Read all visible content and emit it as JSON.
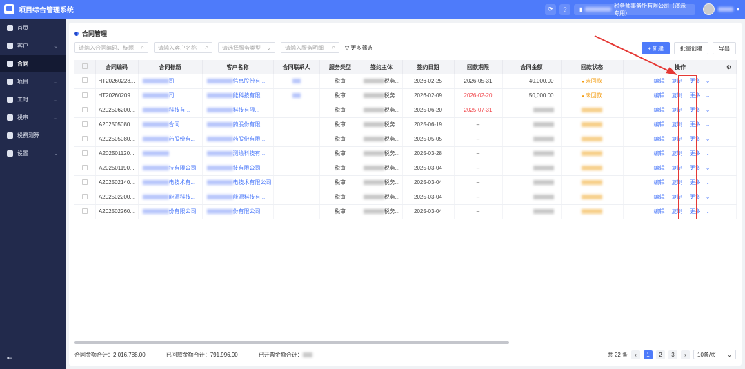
{
  "app": {
    "title": "项目综合管理系统",
    "org_suffix": "税务师事务所有限公司（演示专用）"
  },
  "sidebar": {
    "items": [
      {
        "label": "首页"
      },
      {
        "label": "客户"
      },
      {
        "label": "合同"
      },
      {
        "label": "项目"
      },
      {
        "label": "工时"
      },
      {
        "label": "税审"
      },
      {
        "label": "税费测算"
      },
      {
        "label": "设置"
      }
    ]
  },
  "page": {
    "title": "合同管理"
  },
  "filters": {
    "code_placeholder": "请输入合同编码、标题",
    "customer_placeholder": "请输入客户名称",
    "service_placeholder": "请选择服务类型",
    "detail_placeholder": "请输入服务明细",
    "more": "更多筛选"
  },
  "toolbar": {
    "new": "+ 新建",
    "batch": "批量创建",
    "export": "导出"
  },
  "table": {
    "headers": [
      "合同编码",
      "合同标题",
      "客户名称",
      "合同联系人",
      "服务类型",
      "签约主体",
      "签约日期",
      "回款期限",
      "合同金额",
      "回款状态",
      "操作"
    ],
    "actions": {
      "edit": "编辑",
      "copy": "复制",
      "more": "更多"
    },
    "rows": [
      {
        "code": "HT20260228...",
        "title": "司",
        "customer": "信息股份有...",
        "contact": true,
        "service": "税审",
        "party": "税务...",
        "date": "2026-02-25",
        "due": "2026-05-31",
        "due_red": false,
        "amount": "40,000.00",
        "status": "未回款"
      },
      {
        "code": "HT20260209...",
        "title": "司",
        "customer": "能科技有限...",
        "contact": true,
        "service": "税审",
        "party": "税务...",
        "date": "2026-02-09",
        "due": "2026-02-20",
        "due_red": true,
        "amount": "50,000.00",
        "status": "未回款"
      },
      {
        "code": "A202506200...",
        "title": "科技有...",
        "customer": "科技有限...",
        "service": "税审",
        "party": "税务...",
        "date": "2025-06-20",
        "due": "2025-07-31",
        "due_red": true
      },
      {
        "code": "A202505080...",
        "title": "合同",
        "customer": "药股份有限...",
        "service": "税审",
        "party": "税务...",
        "date": "2025-06-19",
        "due": "–"
      },
      {
        "code": "A202505080...",
        "title": "药股份有...",
        "customer": "药股份有限...",
        "service": "税审",
        "party": "税务...",
        "date": "2025-05-05",
        "due": "–"
      },
      {
        "code": "A202501120...",
        "title": "",
        "customer": "测绘科技有...",
        "service": "税审",
        "party": "税务...",
        "date": "2025-03-28",
        "due": "–"
      },
      {
        "code": "A202501190...",
        "title": "技有限公司",
        "customer": "技有限公司",
        "service": "税审",
        "party": "税务...",
        "date": "2025-03-04",
        "due": "–"
      },
      {
        "code": "A202502140...",
        "title": "电技术有...",
        "customer": "电技术有限公司",
        "service": "税审",
        "party": "税务...",
        "date": "2025-03-04",
        "due": "–"
      },
      {
        "code": "A202502200...",
        "title": "能源科技...",
        "customer": "能源科技有...",
        "service": "税审",
        "party": "税务...",
        "date": "2025-03-04",
        "due": "–"
      },
      {
        "code": "A202502260...",
        "title": "份有限公司",
        "customer": "份有限公司",
        "service": "税审",
        "party": "税务...",
        "date": "2025-03-04",
        "due": "–"
      }
    ]
  },
  "footer": {
    "total_amount": "合同金额合计：2,016,788.00",
    "received": "已回款金额合计：791,996.90",
    "invoiced": "已开票金额合计："
  },
  "pagination": {
    "total": "共 22 条",
    "pages": [
      "1",
      "2",
      "3"
    ],
    "current": "1",
    "size": "10条/页"
  },
  "colors": {
    "primary": "#4e7bfa",
    "sidebar": "#222a4c",
    "danger": "#f0464b",
    "warning": "#f39c12",
    "annotation": "#e53935"
  }
}
